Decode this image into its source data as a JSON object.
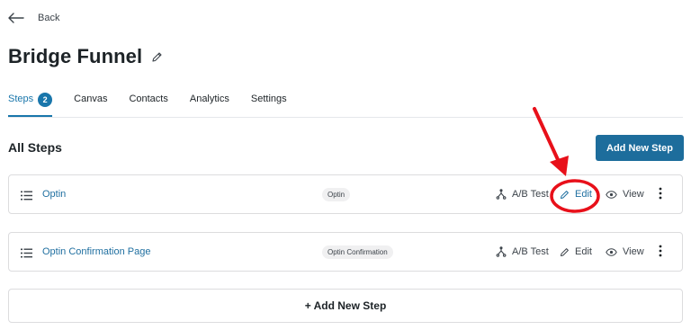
{
  "header": {
    "back_label": "Back",
    "title": "Bridge Funnel"
  },
  "tabs": [
    {
      "label": "Steps",
      "badge": "2",
      "active": true
    },
    {
      "label": "Canvas"
    },
    {
      "label": "Contacts"
    },
    {
      "label": "Analytics"
    },
    {
      "label": "Settings"
    }
  ],
  "section": {
    "title": "All Steps",
    "add_button_label": "Add New Step"
  },
  "steps": [
    {
      "name": "Optin",
      "type": "Optin",
      "ab_label": "A/B Test",
      "edit_label": "Edit",
      "view_label": "View"
    },
    {
      "name": "Optin Confirmation Page",
      "type": "Optin Confirmation",
      "ab_label": "A/B Test",
      "edit_label": "Edit",
      "view_label": "View"
    }
  ],
  "footer": {
    "add_step_label": "+ Add New Step"
  },
  "colors": {
    "accent": "#1976ab",
    "primary_button": "#1d6d9c",
    "annotation": "#e8101a"
  },
  "icons": [
    "arrow-left-icon",
    "pencil-icon",
    "drag-handle-icon",
    "split-test-icon",
    "eye-icon",
    "more-vertical-icon"
  ]
}
